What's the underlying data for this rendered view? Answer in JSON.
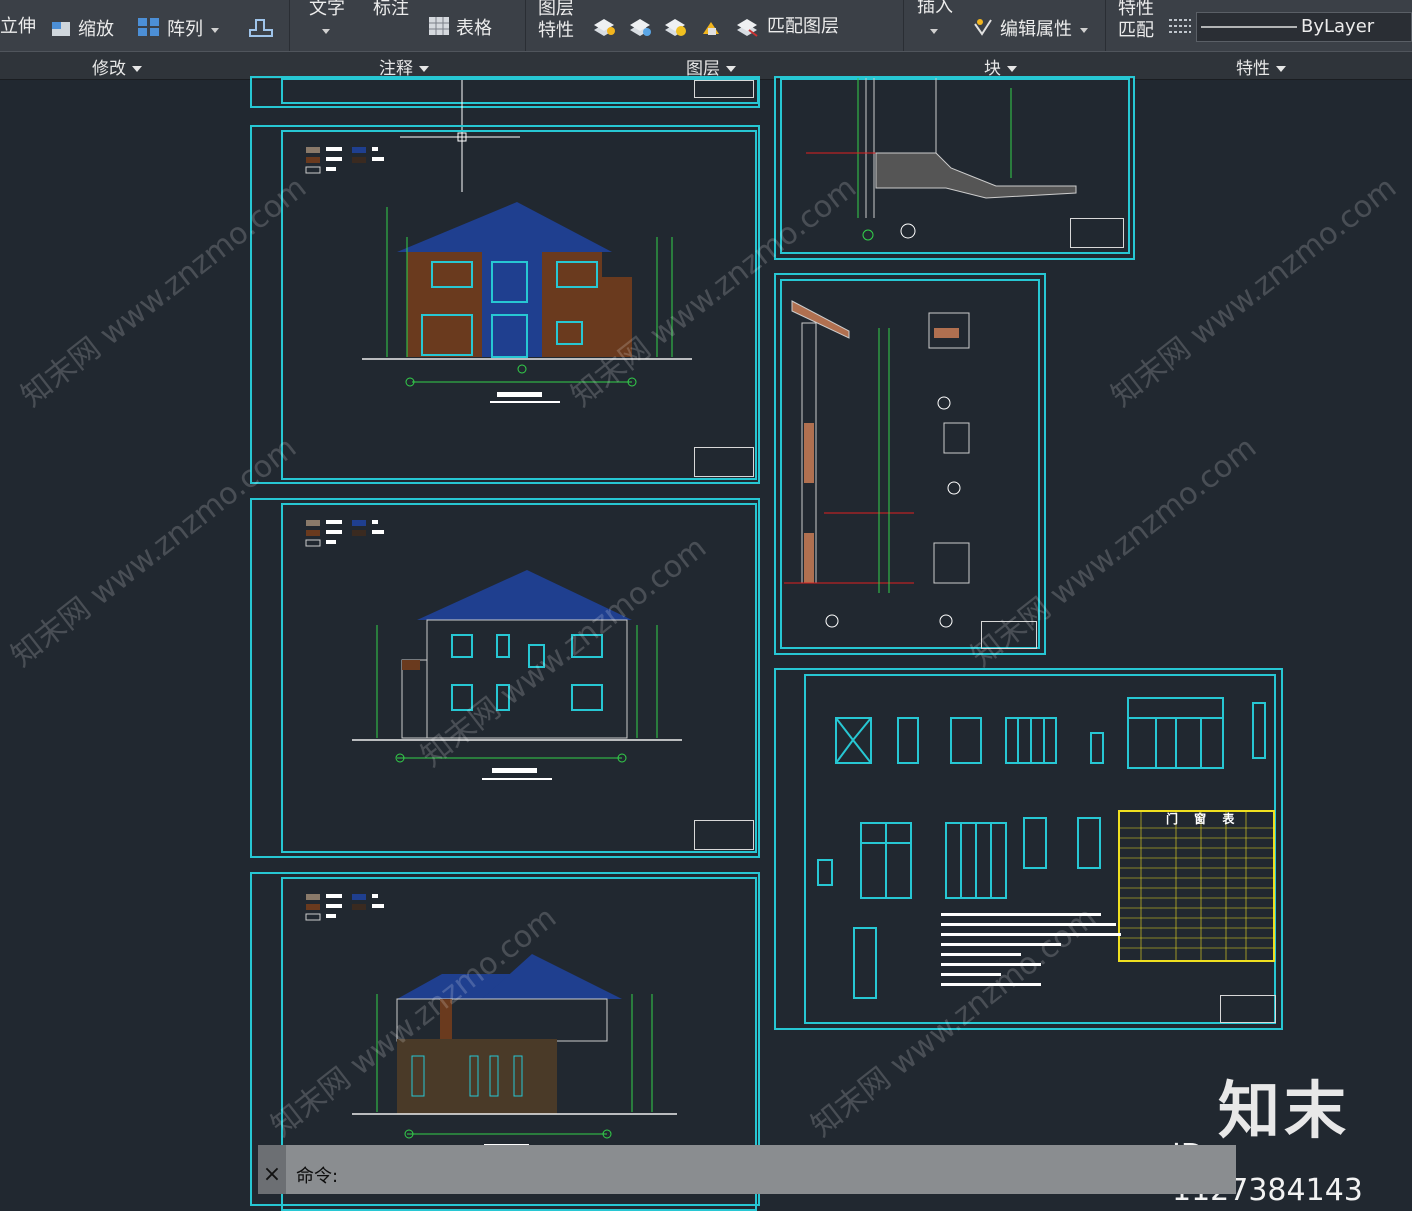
{
  "ribbon": {
    "buttons": {
      "stretch": "立伸",
      "scale": "缩放",
      "array": "阵列",
      "text": "文字",
      "dimension": "标注",
      "table": "表格",
      "layer_props_line1": "图层",
      "layer_props_line2": "特性",
      "match_layer": "匹配图层",
      "insert": "插入",
      "edit_attributes": "编辑属性",
      "match_props_line1": "特性",
      "match_props_line2": "匹配"
    },
    "linetype_value": "ByLayer",
    "panels": {
      "modify": "修改",
      "annotation": "注释",
      "layers": "图层",
      "block": "块",
      "properties": "特性"
    }
  },
  "command_line": {
    "prompt": "命令:",
    "close_glyph": "×"
  },
  "drawing": {
    "door_window_table_title": "门 窗 表"
  },
  "watermark": {
    "text": "知末网 www.znzmo.com",
    "brand": "知末",
    "id": "ID: 1127384143"
  },
  "colors": {
    "background": "#212830",
    "sheet_border": "#27c7d3",
    "ribbon": "#3b4047",
    "roof": "#1f3f8f",
    "dim_green": "#33d14a",
    "brick": "#6a3a1e"
  }
}
